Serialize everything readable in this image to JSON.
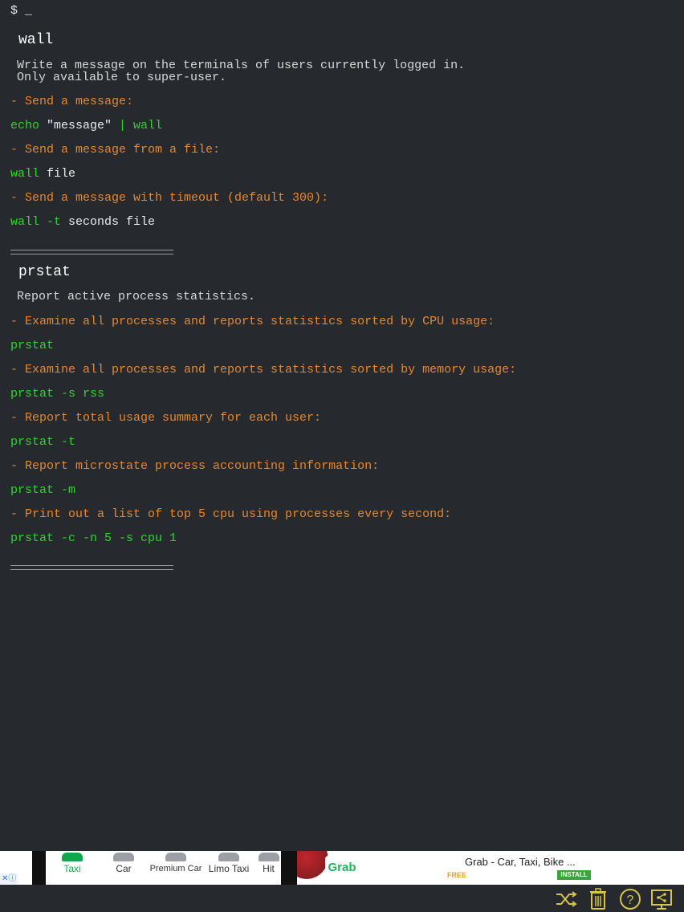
{
  "terminal": {
    "prompt": "$ _",
    "sections": [
      {
        "title": "wall",
        "description": [
          "Write a message on the terminals of users currently logged in.",
          "Only available to super-user."
        ],
        "examples": [
          {
            "label": "- Send a message:",
            "command": "echo",
            "args": [
              {
                "t": "str",
                "v": " \"message\""
              },
              {
                "t": "code",
                "v": " | wall"
              }
            ]
          },
          {
            "label": "- Send a message from a file:",
            "command": "wall",
            "args": [
              {
                "t": "arg",
                "v": " file"
              }
            ]
          },
          {
            "label": "- Send a message with timeout (default 300):",
            "command": "wall -t",
            "args": [
              {
                "t": "arg",
                "v": " seconds file"
              }
            ]
          }
        ]
      },
      {
        "title": "prstat",
        "description": [
          "Report active process statistics."
        ],
        "examples": [
          {
            "label": "- Examine all processes and reports statistics sorted by CPU usage:",
            "command": "prstat",
            "args": []
          },
          {
            "label": "- Examine all processes and reports statistics sorted by memory usage:",
            "command": "prstat -s rss",
            "args": []
          },
          {
            "label": "- Report total usage summary for each user:",
            "command": "prstat -t",
            "args": []
          },
          {
            "label": "- Report microstate process accounting information:",
            "command": "prstat -m",
            "args": []
          },
          {
            "label": "- Print out a list of top 5 cpu using processes every second:",
            "command": "prstat -c -n 5 -s cpu 1",
            "args": []
          }
        ]
      }
    ]
  },
  "ad": {
    "tabs": [
      {
        "label": "Taxi",
        "active": true
      },
      {
        "label": "Car",
        "active": false
      },
      {
        "label": "Premium Car",
        "active": false
      },
      {
        "label": "Limo Taxi",
        "active": false
      },
      {
        "label": "Hit",
        "active": false
      }
    ],
    "logo_text": "Grab",
    "title": "Grab - Car, Taxi, Bike ...",
    "price": "FREE",
    "install_label": "INSTALL",
    "info_badge": "✕ⓘ"
  },
  "toolbar": {
    "icons": [
      "shuffle-icon",
      "trash-icon",
      "help-icon",
      "share-icon"
    ]
  },
  "colors": {
    "background": "#26292d",
    "example_label": "#e8872e",
    "command": "#2fd52f",
    "argument": "#ececec",
    "toolbar_icon": "#d8c24a"
  }
}
